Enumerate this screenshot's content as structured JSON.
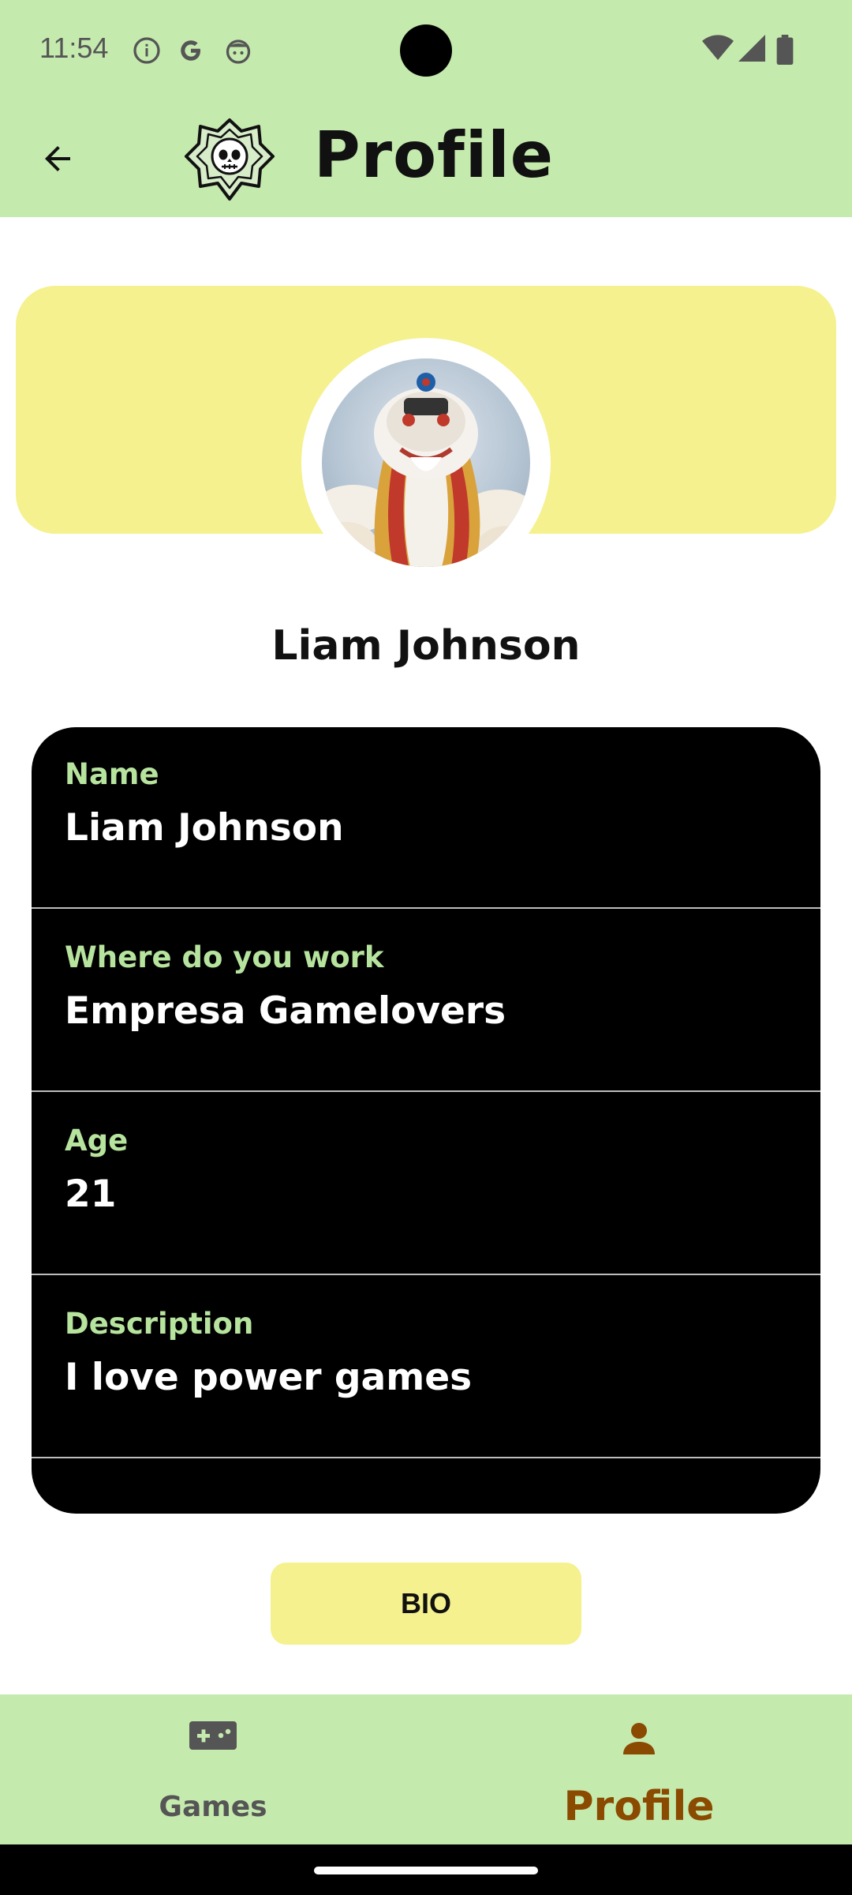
{
  "status_bar": {
    "time": "11:54",
    "icons": [
      "info-icon",
      "google-icon",
      "face-icon",
      "wifi-icon",
      "signal-icon",
      "battery-icon"
    ]
  },
  "app_bar": {
    "title": "Profile",
    "back_icon": "arrow-back-icon",
    "logo_icon": "skull-badge-logo"
  },
  "profile": {
    "display_name": "Liam Johnson",
    "avatar": "lion-dance-avatar"
  },
  "fields": [
    {
      "label": "Name",
      "value": "Liam Johnson"
    },
    {
      "label": "Where do you work",
      "value": "Empresa Gamelovers"
    },
    {
      "label": "Age",
      "value": "21"
    },
    {
      "label": "Description",
      "value": "I love power games"
    }
  ],
  "bio_button": {
    "label": "BIO"
  },
  "bottom_nav": {
    "items": [
      {
        "label": "Games",
        "icon": "gamepad-icon",
        "selected": false
      },
      {
        "label": "Profile",
        "icon": "person-icon",
        "selected": true
      }
    ]
  },
  "colors": {
    "bar_green": "#c5eaae",
    "banner_yellow": "#f5f18e",
    "label_green": "#b6e39d",
    "active_brown": "#8a4a00"
  }
}
